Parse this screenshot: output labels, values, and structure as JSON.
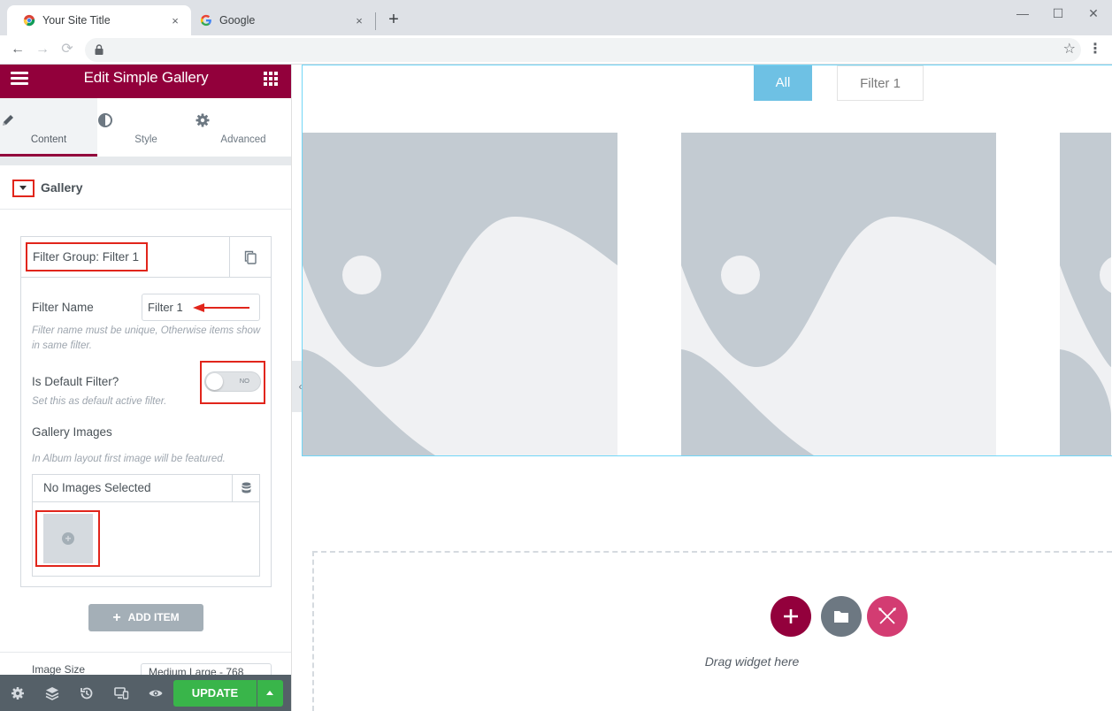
{
  "browser": {
    "tabs": [
      {
        "title": "Your Site Title",
        "active": true
      },
      {
        "title": "Google",
        "active": false
      }
    ],
    "close_glyph": "×",
    "new_tab_glyph": "+",
    "window_controls": [
      "—",
      "☐",
      "✕"
    ],
    "nav": {
      "back": "←",
      "forward": "→",
      "reload": "⟳"
    },
    "star_glyph": "☆",
    "menu_glyph": "⋮"
  },
  "panel": {
    "header_title": "Edit Simple Gallery",
    "tabs": [
      {
        "label": "Content",
        "icon": "pencil-icon",
        "active": true
      },
      {
        "label": "Style",
        "icon": "half-circle-icon",
        "active": false
      },
      {
        "label": "Advanced",
        "icon": "gear-icon",
        "active": false
      }
    ],
    "section_title": "Gallery",
    "repeater": {
      "item_title": "Filter Group: Filter 1",
      "filter_name_label": "Filter Name",
      "filter_name_value": "Filter 1",
      "filter_name_help": "Filter name must be unique, Otherwise items show in same filter.",
      "default_filter_label": "Is Default Filter?",
      "default_filter_state": "NO",
      "default_filter_help": "Set this as default active filter.",
      "gallery_images_label": "Gallery Images",
      "gallery_images_help": "In Album layout first image will be featured.",
      "no_images_text": "No Images Selected"
    },
    "add_item_label": "ADD ITEM",
    "add_item_glyph": "+",
    "next_field_label": "Image Size",
    "next_field_value": "Medium Large - 768",
    "footer": {
      "icons": [
        "gear-icon",
        "layers-icon",
        "history-icon",
        "responsive-icon",
        "eye-icon"
      ],
      "update_label": "UPDATE"
    },
    "collapse_glyph": "‹"
  },
  "canvas": {
    "filters": [
      {
        "label": "All",
        "active": true
      },
      {
        "label": "Filter 1",
        "active": false
      }
    ],
    "drop_zone_text": "Drag widget here"
  },
  "colors": {
    "brand": "#92003b",
    "filter_active": "#6ec1e4",
    "update_green": "#39b54a",
    "highlight_red": "#e1251b",
    "placeholder_grey": "#c3cbd2",
    "add_section": "#93003c",
    "template_btn": "#6d7882",
    "theme_builder": "#d33c72"
  }
}
